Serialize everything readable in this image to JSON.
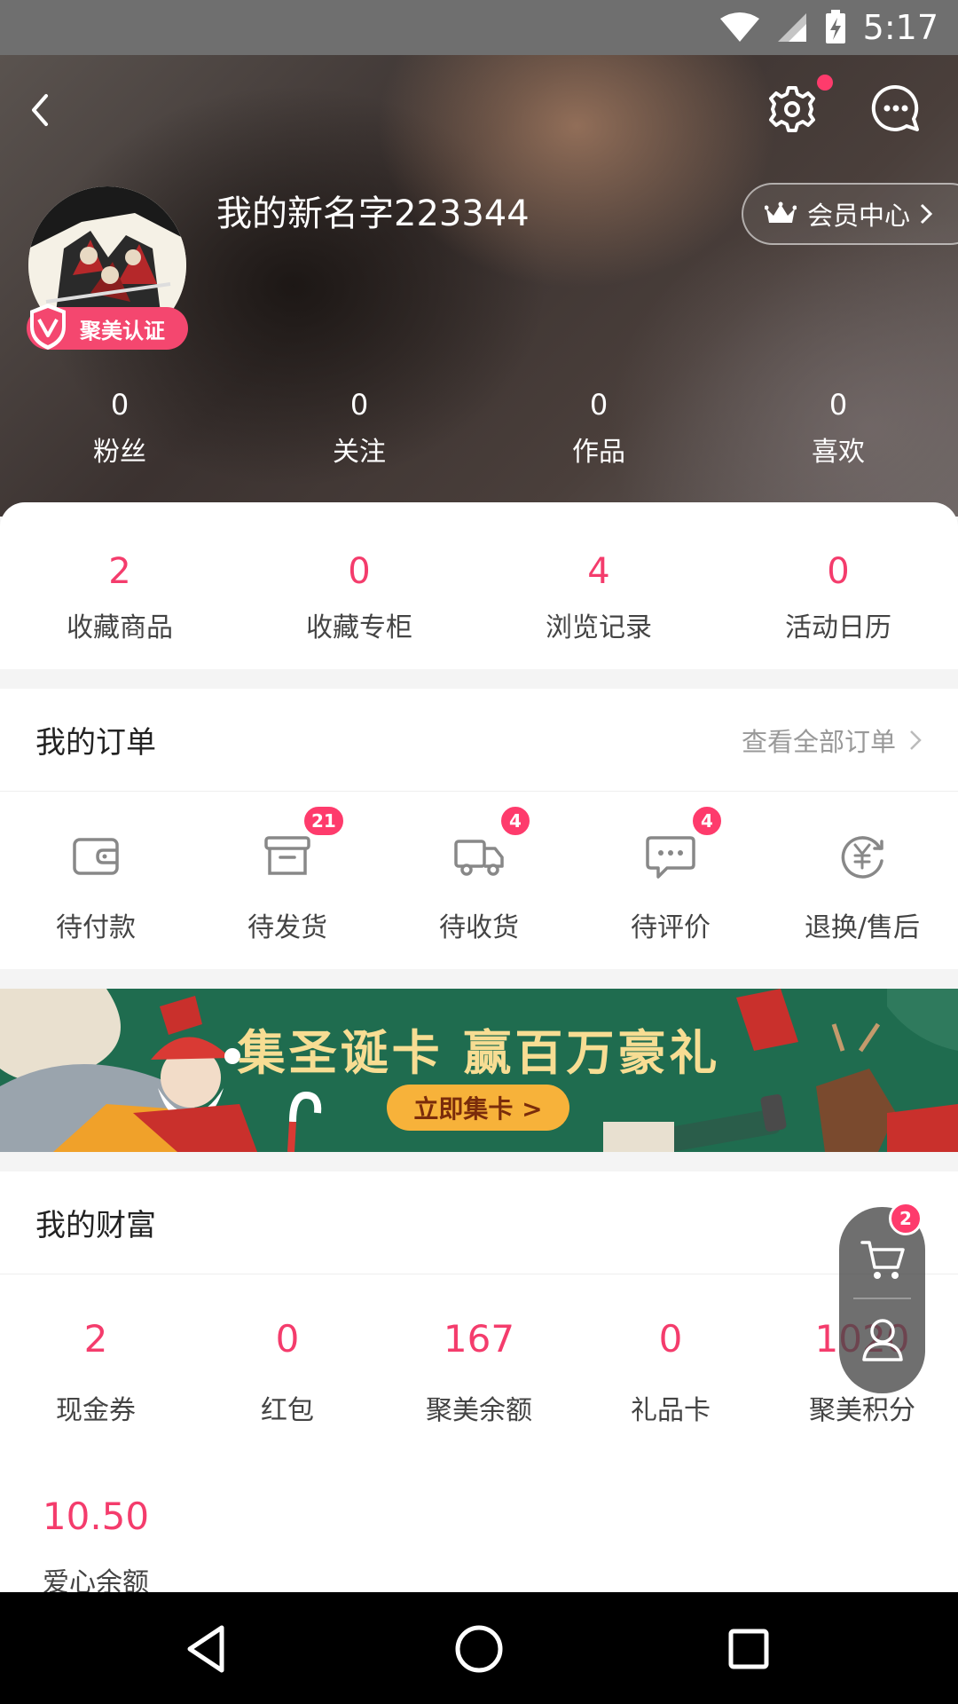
{
  "status_bar": {
    "time": "5:17"
  },
  "profile": {
    "username": "我的新名字223344",
    "verify_label": "聚美认证",
    "vip_label": "会员中心"
  },
  "social_stats": [
    {
      "value": "0",
      "label": "粉丝"
    },
    {
      "value": "0",
      "label": "关注"
    },
    {
      "value": "0",
      "label": "作品"
    },
    {
      "value": "0",
      "label": "喜欢"
    }
  ],
  "collection_stats": [
    {
      "value": "2",
      "label": "收藏商品"
    },
    {
      "value": "0",
      "label": "收藏专柜"
    },
    {
      "value": "4",
      "label": "浏览记录"
    },
    {
      "value": "0",
      "label": "活动日历"
    }
  ],
  "orders": {
    "title": "我的订单",
    "view_all": "查看全部订单",
    "items": [
      {
        "label": "待付款",
        "icon": "wallet-icon",
        "badge": ""
      },
      {
        "label": "待发货",
        "icon": "box-icon",
        "badge": "21"
      },
      {
        "label": "待收货",
        "icon": "truck-icon",
        "badge": "4"
      },
      {
        "label": "待评价",
        "icon": "comment-icon",
        "badge": "4"
      },
      {
        "label": "退换/售后",
        "icon": "refund-icon",
        "badge": ""
      }
    ]
  },
  "banner": {
    "title": "集圣诞卡 赢百万豪礼",
    "button": "立即集卡 >"
  },
  "wealth": {
    "title": "我的财富",
    "items": [
      {
        "value": "2",
        "label": "现金券"
      },
      {
        "value": "0",
        "label": "红包"
      },
      {
        "value": "167",
        "label": "聚美余额"
      },
      {
        "value": "0",
        "label": "礼品卡"
      },
      {
        "value": "1020",
        "label": "聚美积分"
      }
    ],
    "extra": {
      "value": "10.50",
      "label": "爱心余额"
    }
  },
  "float_cart": {
    "badge": "2"
  },
  "colors": {
    "accent": "#f43c6c",
    "badge": "#fe3b6c"
  }
}
